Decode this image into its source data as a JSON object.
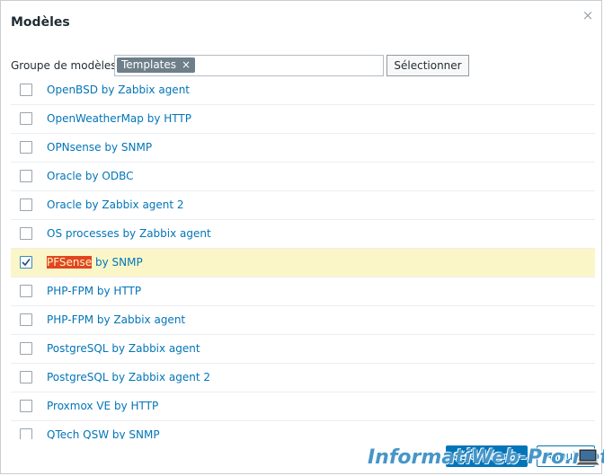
{
  "dialog": {
    "title": "Modèles",
    "close_label": "×"
  },
  "group": {
    "label": "Groupe de modèles",
    "chip": "Templates",
    "chip_remove": "×",
    "select_button": "Sélectionner"
  },
  "list": {
    "items": [
      {
        "label": "OpenBSD by Zabbix agent",
        "checked": false
      },
      {
        "label": "OpenWeatherMap by HTTP",
        "checked": false
      },
      {
        "label": "OPNsense by SNMP",
        "checked": false
      },
      {
        "label": "Oracle by ODBC",
        "checked": false
      },
      {
        "label": "Oracle by Zabbix agent 2",
        "checked": false
      },
      {
        "label": "OS processes by Zabbix agent",
        "checked": false
      },
      {
        "label_highlight": "PFSense",
        "label_rest": " by SNMP",
        "checked": true
      },
      {
        "label": "PHP-FPM by HTTP",
        "checked": false
      },
      {
        "label": "PHP-FPM by Zabbix agent",
        "checked": false
      },
      {
        "label": "PostgreSQL by Zabbix agent",
        "checked": false
      },
      {
        "label": "PostgreSQL by Zabbix agent 2",
        "checked": false
      },
      {
        "label": "Proxmox VE by HTTP",
        "checked": false
      },
      {
        "label": "QTech QSW by SNMP",
        "checked": false
      }
    ]
  },
  "footer": {
    "select_button": "Sélectionner",
    "cancel_button": "Annuler"
  },
  "watermark": {
    "text": "InformatiWeb-Pro.net"
  },
  "colors": {
    "link": "#0275b8",
    "selected_row": "#fbf6c8",
    "highlight": "#e1451f"
  }
}
